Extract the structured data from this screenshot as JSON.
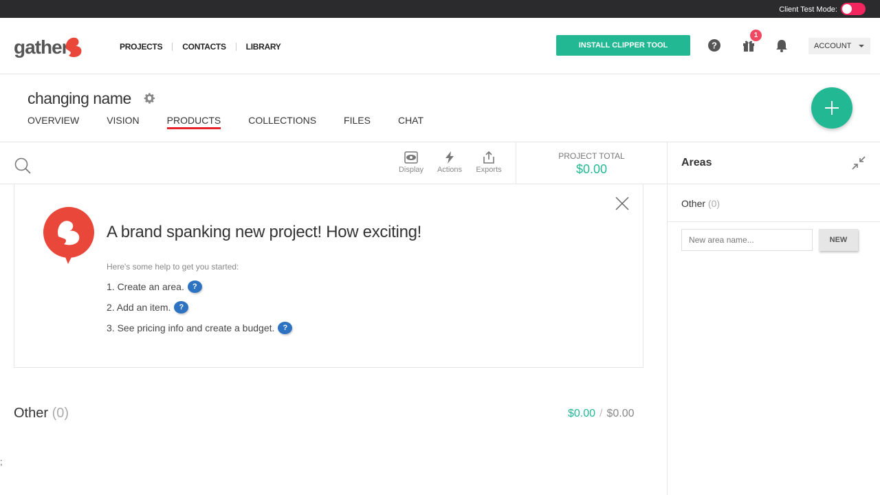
{
  "topbar": {
    "client_test_mode_label": "Client Test Mode:",
    "toggle_color": "#f2255e"
  },
  "header": {
    "logo_text": "gather",
    "nav": [
      "PROJECTS",
      "CONTACTS",
      "LIBRARY"
    ],
    "install_button": "INSTALL CLIPPER TOOL",
    "gift_badge": "1",
    "account_label": "ACCOUNT",
    "icons": [
      "help-icon",
      "gift-icon",
      "bell-icon"
    ]
  },
  "project": {
    "name": "changing name",
    "tabs": [
      "OVERVIEW",
      "VISION",
      "PRODUCTS",
      "COLLECTIONS",
      "FILES",
      "CHAT"
    ],
    "active_tab": "PRODUCTS"
  },
  "toolbar": {
    "display": "Display",
    "actions": "Actions",
    "exports": "Exports",
    "total_label": "PROJECT TOTAL",
    "total_value": "$0.00"
  },
  "welcome": {
    "title": "A brand spanking new project! How exciting!",
    "intro": "Here's some help to get you started:",
    "steps": [
      "1. Create an area.",
      "2. Add an item.",
      "3. See pricing info and create a budget."
    ],
    "help_glyph": "?"
  },
  "area_section": {
    "name": "Other",
    "count": "(0)",
    "spent": "$0.00",
    "separator": "/",
    "budget": "$0.00"
  },
  "misc": {
    "stray_char": ";"
  },
  "sidebar": {
    "title": "Areas",
    "areas": [
      {
        "name": "Other",
        "count": "(0)"
      }
    ],
    "new_area_placeholder": "New area name...",
    "new_button": "NEW"
  },
  "colors": {
    "accent": "#22b893",
    "brand_red": "#e8473a",
    "active_underline": "#e8202a",
    "help_blue": "#2d73c2"
  }
}
